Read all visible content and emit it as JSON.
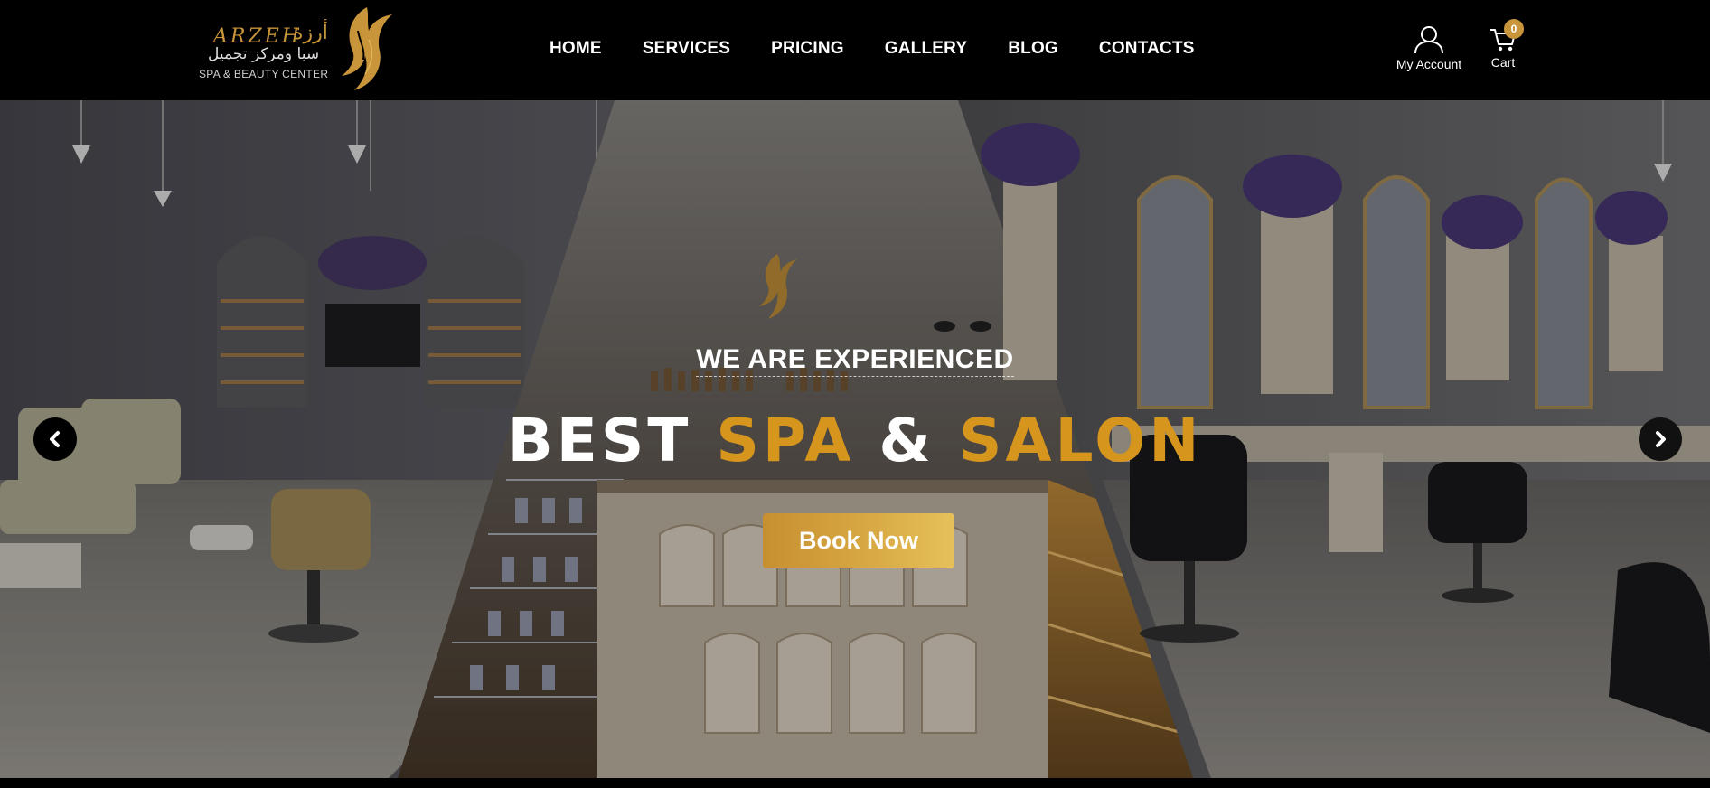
{
  "logo": {
    "latin_name": "ARZEH",
    "arabic_name": "أرزة",
    "arabic_subtitle": "سبا ومركز تجميل",
    "subtitle": "SPA & BEAUTY CENTER",
    "emblem_icon": "woman-silhouette-icon"
  },
  "nav": {
    "items": [
      "HOME",
      "SERVICES",
      "PRICING",
      "GALLERY",
      "BLOG",
      "CONTACTS"
    ]
  },
  "account": {
    "label": "My Account",
    "icon": "user-icon"
  },
  "cart": {
    "label": "Cart",
    "count": "0",
    "icon": "cart-icon"
  },
  "hero": {
    "kicker": "WE ARE EXPERIENCED",
    "headline": {
      "word1": "BEST",
      "word2": "SPA",
      "amp": "&",
      "word3": "SALON"
    },
    "cta_label": "Book Now",
    "prev_icon": "chevron-left-icon",
    "next_icon": "chevron-right-icon"
  },
  "colors": {
    "header_bg": "#000000",
    "gold": "#c9953a",
    "headline_gold": "#d6951c",
    "text": "#ffffff"
  }
}
